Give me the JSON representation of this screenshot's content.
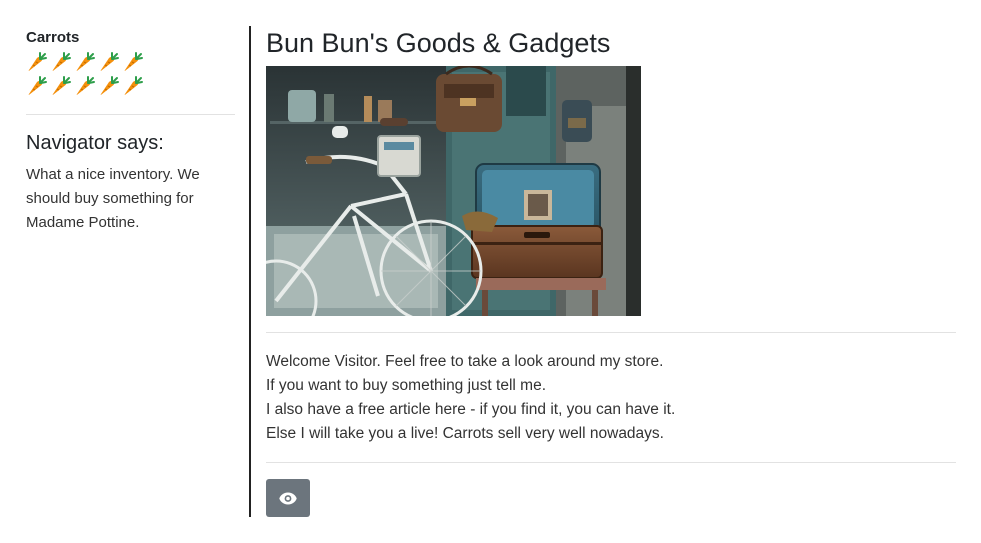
{
  "sidebar": {
    "carrots_title": "Carrots",
    "carrot_count": 10,
    "carrot_icon": "carrot-icon",
    "navigator_title": "Navigator says:",
    "navigator_text": "What a nice inventory. We should buy something for Madame Pottine."
  },
  "main": {
    "title": "Bun Bun's Goods & Gadgets",
    "image_icon": "shop-photo-bicycle-suitcase",
    "welcome_lines": [
      "Welcome Visitor. Feel free to take a look around my store.",
      "If you want to buy something just tell me.",
      "I also have a free article here - if you find it, you can have it.",
      "Else I will take you a live! Carrots sell very well nowadays."
    ],
    "look_button_icon": "eye-icon"
  },
  "colors": {
    "button_bg": "#6c757d",
    "carrot_orange": "#f4900c",
    "carrot_green": "#2d9e4a"
  }
}
